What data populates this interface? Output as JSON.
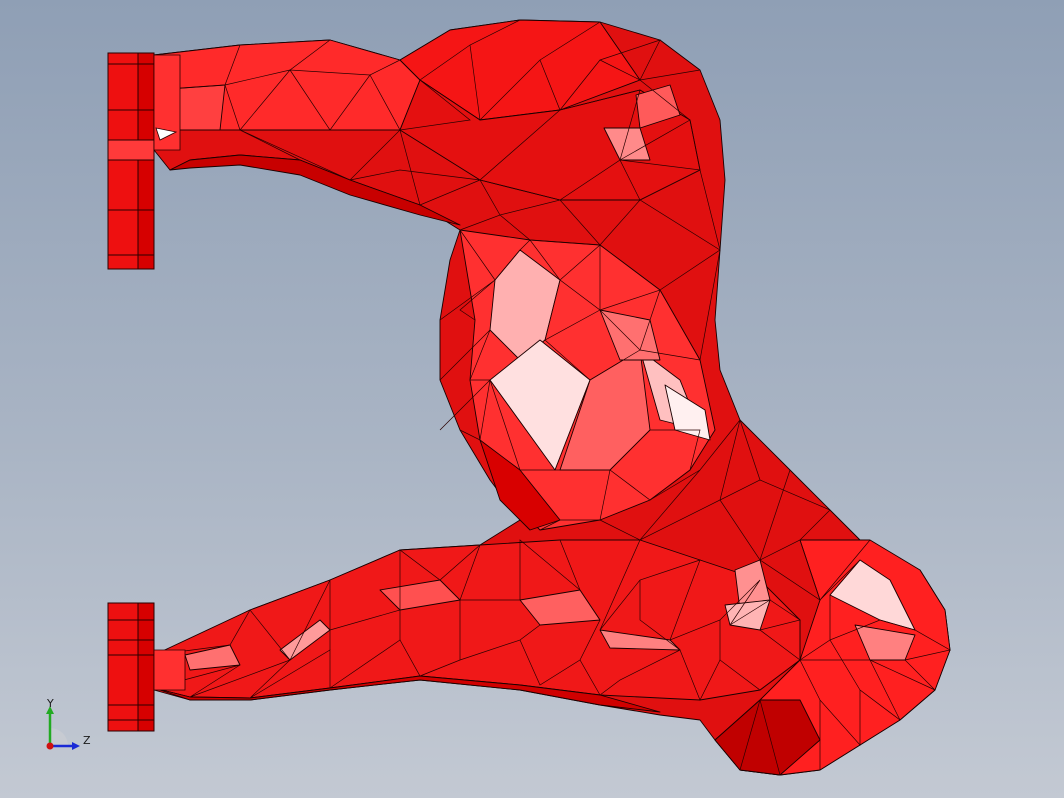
{
  "viewport": {
    "background_top": "#8f9fb5",
    "background_bottom": "#c3c9d3"
  },
  "model": {
    "name": "manifold-mesh",
    "face_color": "#ff1a1a",
    "shade_dark": "#b00000",
    "highlight_color": "#ffe6e6",
    "edge_color": "#1a0000"
  },
  "triad": {
    "y_label": "Y",
    "z_label": "Z",
    "y_color": "#22aa22",
    "z_color": "#1a2ad6",
    "x_color": "#d01010"
  }
}
